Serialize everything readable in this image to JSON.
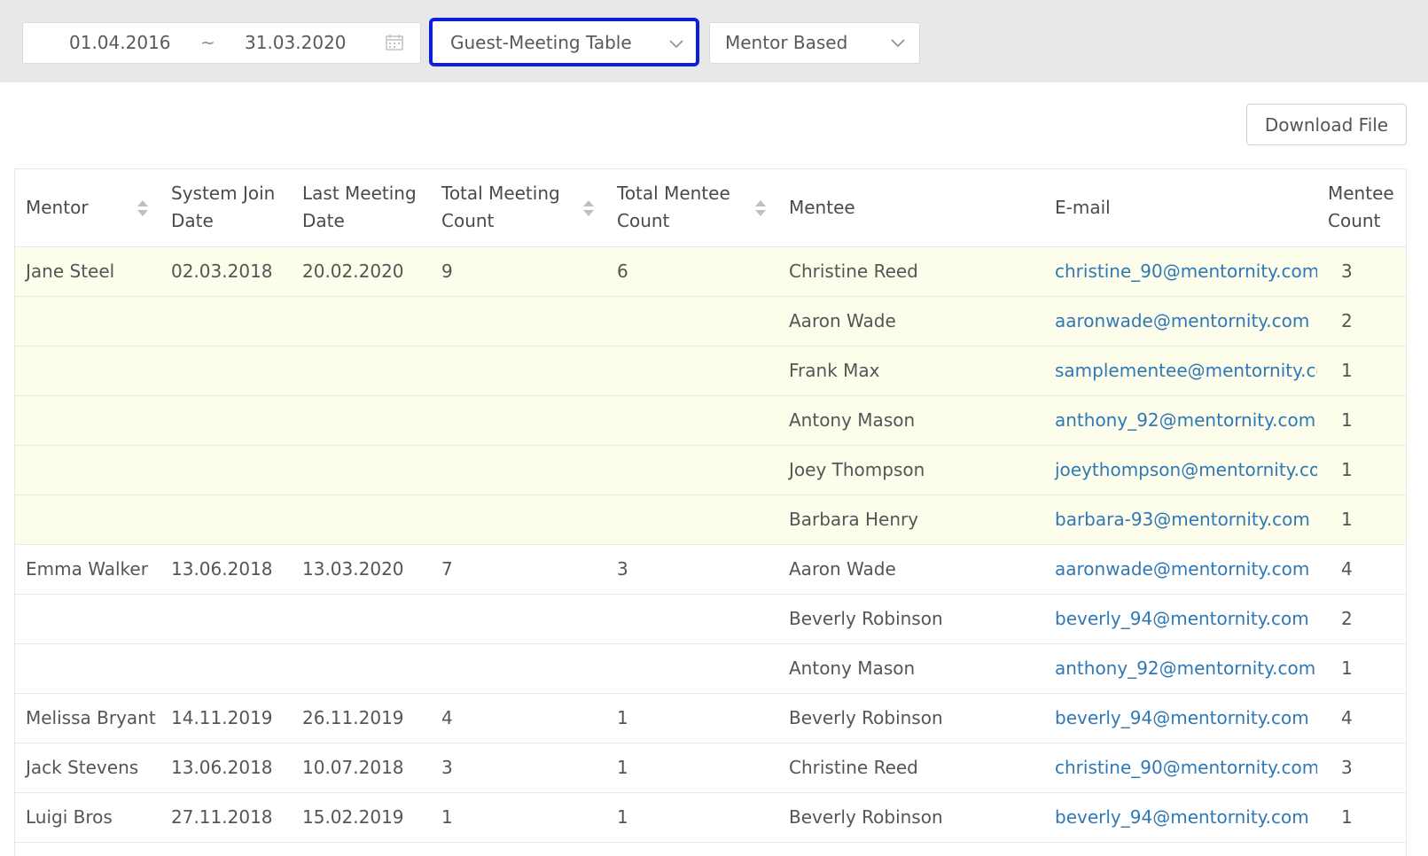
{
  "filters": {
    "date_start": "01.04.2016",
    "date_separator": "~",
    "date_end": "31.03.2020",
    "report_type": "Guest-Meeting Table",
    "grouping": "Mentor Based"
  },
  "download_label": "Download File",
  "columns": {
    "mentor": "Mentor",
    "join_l1": "System Join",
    "join_l2": "Date",
    "last_l1": "Last Meeting",
    "last_l2": "Date",
    "tmc_l1": "Total Meeting",
    "tmc_l2": "Count",
    "tmen_l1": "Total Mentee",
    "tmen_l2": "Count",
    "mentee": "Mentee",
    "email": "E-mail",
    "mc_l1": "Mentee",
    "mc_l2": "Count"
  },
  "rows": [
    {
      "mentor": "Jane Steel",
      "join": "02.03.2018",
      "last": "20.02.2020",
      "tmc": "9",
      "tmen": "6",
      "mentee": "Christine Reed",
      "email": "christine_90@mentornity.com",
      "count": "3",
      "hl": true
    },
    {
      "mentor": "",
      "join": "",
      "last": "",
      "tmc": "",
      "tmen": "",
      "mentee": "Aaron Wade",
      "email": "aaronwade@mentornity.com",
      "count": "2",
      "hl": true
    },
    {
      "mentor": "",
      "join": "",
      "last": "",
      "tmc": "",
      "tmen": "",
      "mentee": "Frank Max",
      "email": "samplementee@mentornity.com",
      "count": "1",
      "hl": true
    },
    {
      "mentor": "",
      "join": "",
      "last": "",
      "tmc": "",
      "tmen": "",
      "mentee": "Antony Mason",
      "email": "anthony_92@mentornity.com",
      "count": "1",
      "hl": true
    },
    {
      "mentor": "",
      "join": "",
      "last": "",
      "tmc": "",
      "tmen": "",
      "mentee": "Joey Thompson",
      "email": "joeythompson@mentornity.com",
      "count": "1",
      "hl": true
    },
    {
      "mentor": "",
      "join": "",
      "last": "",
      "tmc": "",
      "tmen": "",
      "mentee": "Barbara Henry",
      "email": "barbara-93@mentornity.com",
      "count": "1",
      "hl": true
    },
    {
      "mentor": "Emma Walker",
      "join": "13.06.2018",
      "last": "13.03.2020",
      "tmc": "7",
      "tmen": "3",
      "mentee": "Aaron Wade",
      "email": "aaronwade@mentornity.com",
      "count": "4",
      "hl": false
    },
    {
      "mentor": "",
      "join": "",
      "last": "",
      "tmc": "",
      "tmen": "",
      "mentee": "Beverly Robinson",
      "email": "beverly_94@mentornity.com",
      "count": "2",
      "hl": false
    },
    {
      "mentor": "",
      "join": "",
      "last": "",
      "tmc": "",
      "tmen": "",
      "mentee": "Antony Mason",
      "email": "anthony_92@mentornity.com",
      "count": "1",
      "hl": false
    },
    {
      "mentor": "Melissa Bryant",
      "join": "14.11.2019",
      "last": "26.11.2019",
      "tmc": "4",
      "tmen": "1",
      "mentee": "Beverly Robinson",
      "email": "beverly_94@mentornity.com",
      "count": "4",
      "hl": false
    },
    {
      "mentor": "Jack Stevens",
      "join": "13.06.2018",
      "last": "10.07.2018",
      "tmc": "3",
      "tmen": "1",
      "mentee": "Christine Reed",
      "email": "christine_90@mentornity.com",
      "count": "3",
      "hl": false
    },
    {
      "mentor": "Luigi Bros",
      "join": "27.11.2018",
      "last": "15.02.2019",
      "tmc": "1",
      "tmen": "1",
      "mentee": "Beverly Robinson",
      "email": "beverly_94@mentornity.com",
      "count": "1",
      "hl": false
    },
    {
      "mentor": "",
      "join": "",
      "last": "",
      "tmc": "",
      "tmen": "",
      "mentee": "",
      "email": "",
      "count": "",
      "hl": false
    }
  ]
}
